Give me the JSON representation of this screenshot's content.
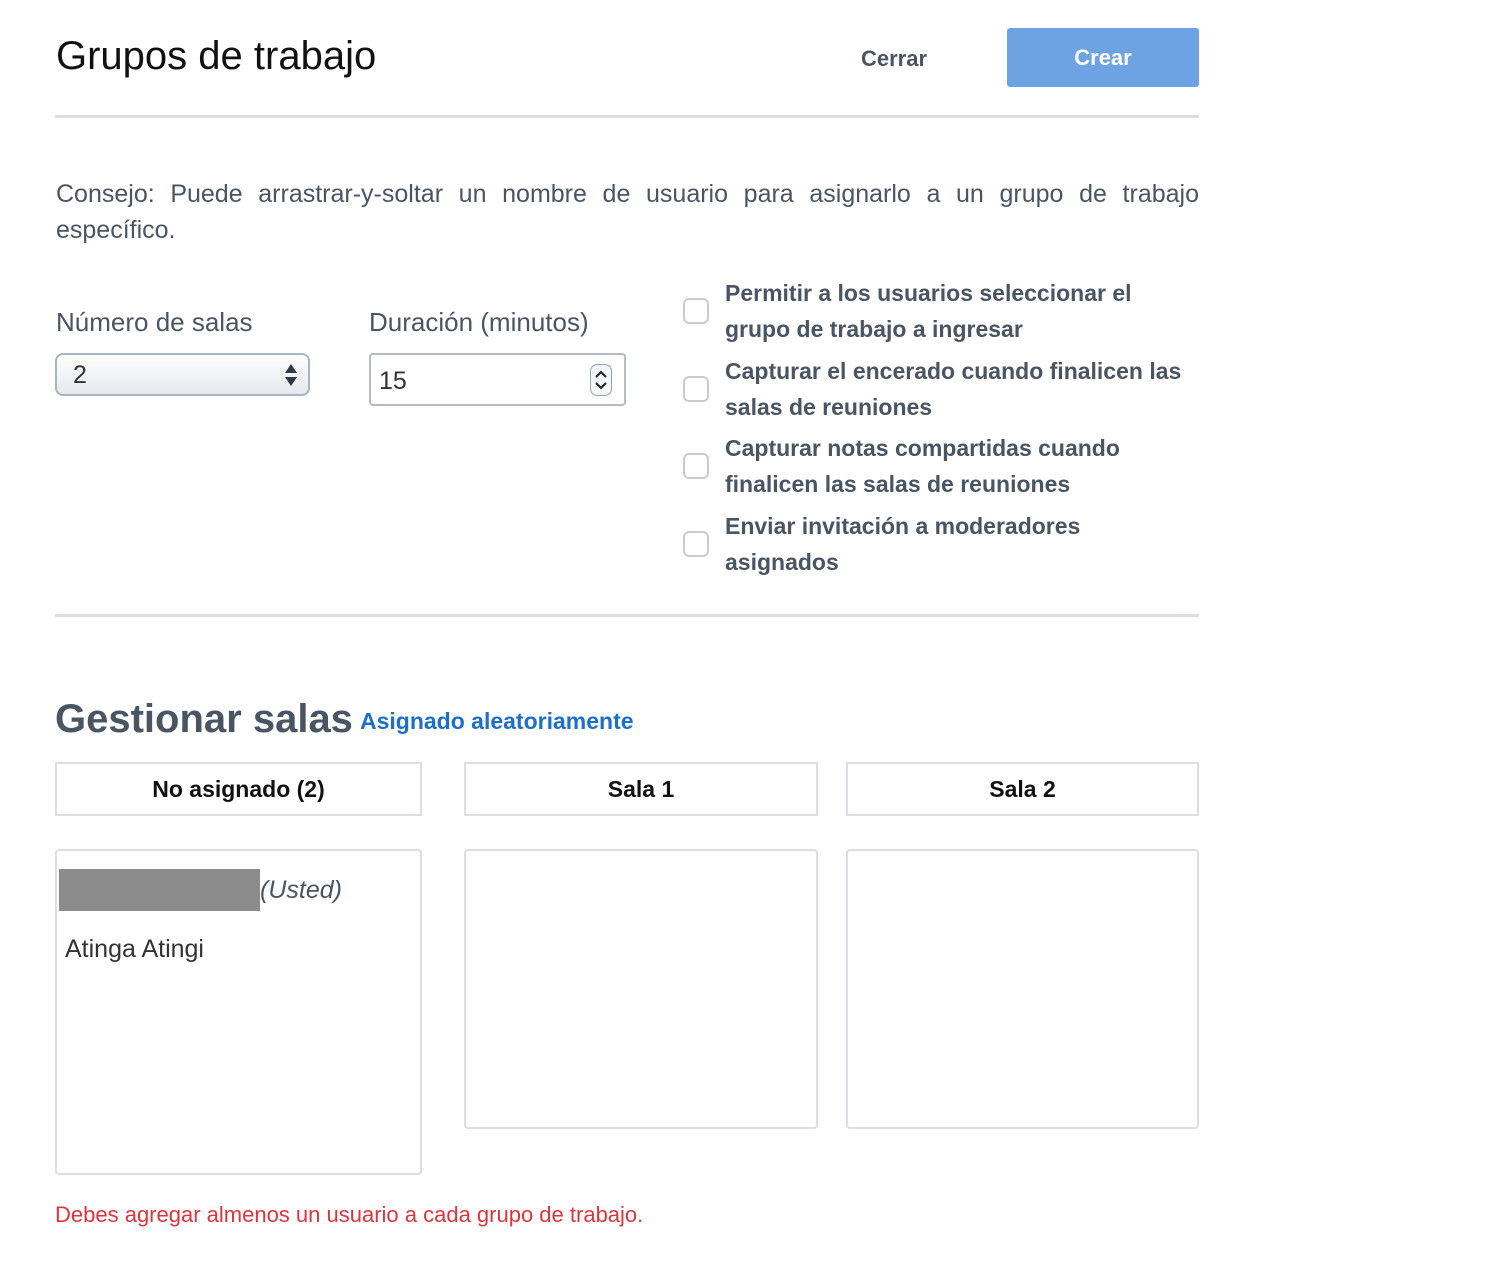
{
  "header": {
    "title": "Grupos de trabajo",
    "close_label": "Cerrar",
    "create_label": "Crear"
  },
  "tip": "Consejo: Puede arrastrar-y-soltar un nombre de usuario para asignarlo a un grupo de trabajo específico.",
  "settings": {
    "rooms_label": "Número de salas",
    "rooms_value": "2",
    "duration_label": "Duración (minutos)",
    "duration_value": "15",
    "checkboxes": [
      {
        "label": "Permitir a los usuarios seleccionar el grupo de trabajo a ingresar",
        "checked": false
      },
      {
        "label": "Capturar el encerado cuando finalicen las salas de reuniones",
        "checked": false
      },
      {
        "label": "Capturar notas compartidas cuando finalicen las salas de reuniones",
        "checked": false
      },
      {
        "label": "Enviar invitación a moderadores asignados",
        "checked": false
      }
    ]
  },
  "manage": {
    "title": "Gestionar salas",
    "random_link": "Asignado aleatoriamente",
    "columns": [
      {
        "header": "No asignado (2)"
      },
      {
        "header": "Sala 1"
      },
      {
        "header": "Sala 2"
      }
    ],
    "unassigned_users": {
      "self_tag": "(Usted)",
      "other_user": "Atinga Atingi"
    }
  },
  "error": "Debes agregar almenos un usuario a cada grupo de trabajo.",
  "colors": {
    "primary_button": "#6ea3e3",
    "link": "#1d6fc8",
    "error": "#d9363e"
  }
}
